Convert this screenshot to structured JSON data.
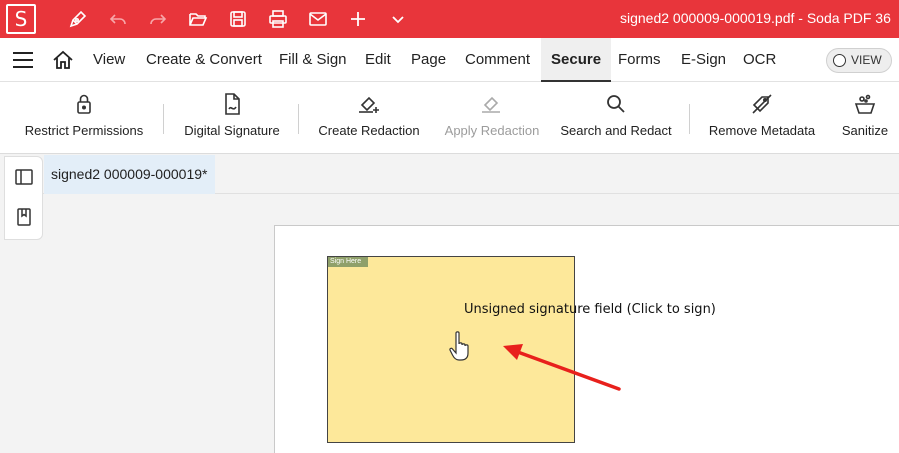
{
  "app": {
    "logo_letter": "S",
    "window_title": "signed2 000009-000019.pdf  -  Soda PDF 36"
  },
  "quick_toolbar": [
    "pen-icon",
    "undo-icon",
    "redo-icon",
    "folder-open-icon",
    "save-icon",
    "print-icon",
    "mail-icon",
    "plus-icon",
    "chevron-down-icon"
  ],
  "menu": {
    "items": [
      "View",
      "Create & Convert",
      "Fill & Sign",
      "Edit",
      "Page",
      "Comment",
      "Secure",
      "Forms",
      "E-Sign",
      "OCR"
    ],
    "active": "Secure",
    "view_toggle_label": "VIEW"
  },
  "ribbon": {
    "items": [
      {
        "label": "Restrict Permissions",
        "icon": "lock-icon",
        "enabled": true
      },
      {
        "label": "Digital Signature",
        "icon": "signed-document-icon",
        "enabled": true
      },
      {
        "label": "Create Redaction",
        "icon": "redaction-create-icon",
        "enabled": true
      },
      {
        "label": "Apply Redaction",
        "icon": "redaction-apply-icon",
        "enabled": false
      },
      {
        "label": "Search and Redact",
        "icon": "magnifier-icon",
        "enabled": true
      },
      {
        "label": "Remove Metadata",
        "icon": "tag-remove-icon",
        "enabled": true
      },
      {
        "label": "Sanitize",
        "icon": "sanitize-icon",
        "enabled": true
      }
    ]
  },
  "document": {
    "tab_title": "signed2 000009-000019*",
    "signature_field": {
      "sign_here_label": "Sign Here",
      "tooltip": "Unsigned signature field (Click to sign)"
    }
  },
  "colors": {
    "brand_red": "#e8353b",
    "signature_field_fill": "#fde89a",
    "annotation_arrow": "#e8201c",
    "doc_tab_bg": "#e3eef8"
  }
}
